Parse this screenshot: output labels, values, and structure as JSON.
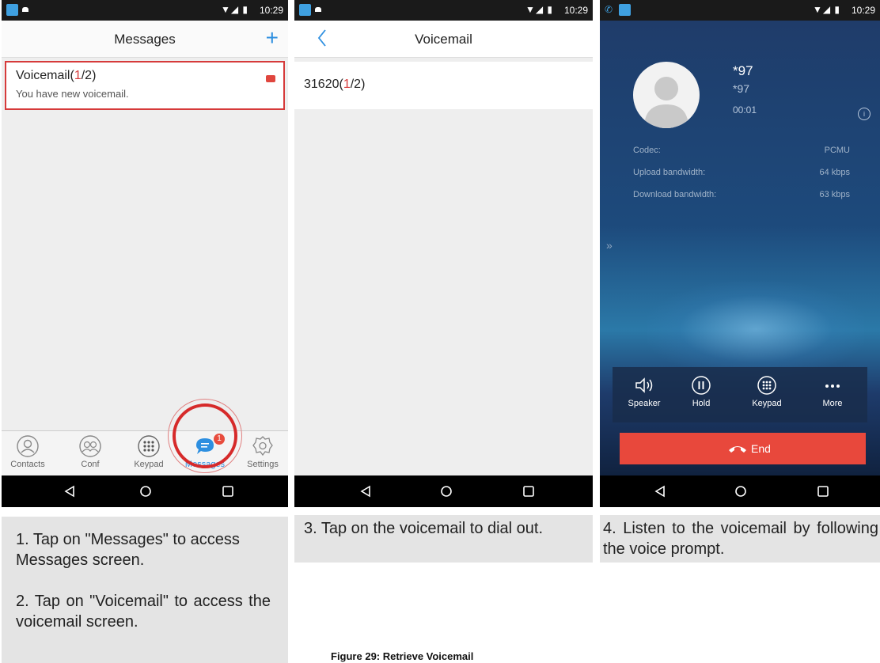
{
  "screen1": {
    "status_time": "10:29",
    "title": "Messages",
    "add_icon": "plus-icon",
    "item_title_prefix": "Voicemail(",
    "item_title_new": "1",
    "item_title_suffix": "/2)",
    "item_subtitle": "You have new voicemail.",
    "tabs": [
      {
        "label": "Contacts",
        "icon": "contacts-icon"
      },
      {
        "label": "Conf",
        "icon": "conference-icon"
      },
      {
        "label": "Keypad",
        "icon": "keypad-icon"
      },
      {
        "label": "Messages",
        "icon": "messages-icon",
        "badge": "1"
      },
      {
        "label": "Settings",
        "icon": "settings-icon"
      }
    ]
  },
  "screen2": {
    "status_time": "10:29",
    "title": "Voicemail",
    "row_prefix": "31620(",
    "row_new": "1",
    "row_suffix": "/2)"
  },
  "screen3": {
    "status_time": "10:29",
    "name": "*97",
    "number": "*97",
    "duration": "00:01",
    "info_icon": "i",
    "stats": [
      {
        "label": "Codec:",
        "value": "PCMU"
      },
      {
        "label": "Upload bandwidth:",
        "value": "64 kbps"
      },
      {
        "label": "Download bandwidth:",
        "value": "63 kbps"
      }
    ],
    "expand_icon": "»",
    "controls": [
      {
        "label": "Speaker",
        "icon": "speaker-icon"
      },
      {
        "label": "Hold",
        "icon": "pause-icon"
      },
      {
        "label": "Keypad",
        "icon": "keypad-icon"
      },
      {
        "label": "More",
        "icon": "more-icon"
      }
    ],
    "end_label": "End"
  },
  "captions": {
    "step1": "1. Tap on \"Messages\" to access Messages screen.",
    "step2": "2. Tap on \"Voicemail\" to access the voicemail screen.",
    "step3": "3. Tap on the voicemail to dial out.",
    "step4": "4. Listen to the voicemail by following the voice prompt."
  },
  "figure_caption": "Figure 29: Retrieve Voicemail",
  "colors": {
    "accent": "#2d8fe0",
    "highlight": "#d63a3a",
    "end_button": "#e8483c"
  }
}
